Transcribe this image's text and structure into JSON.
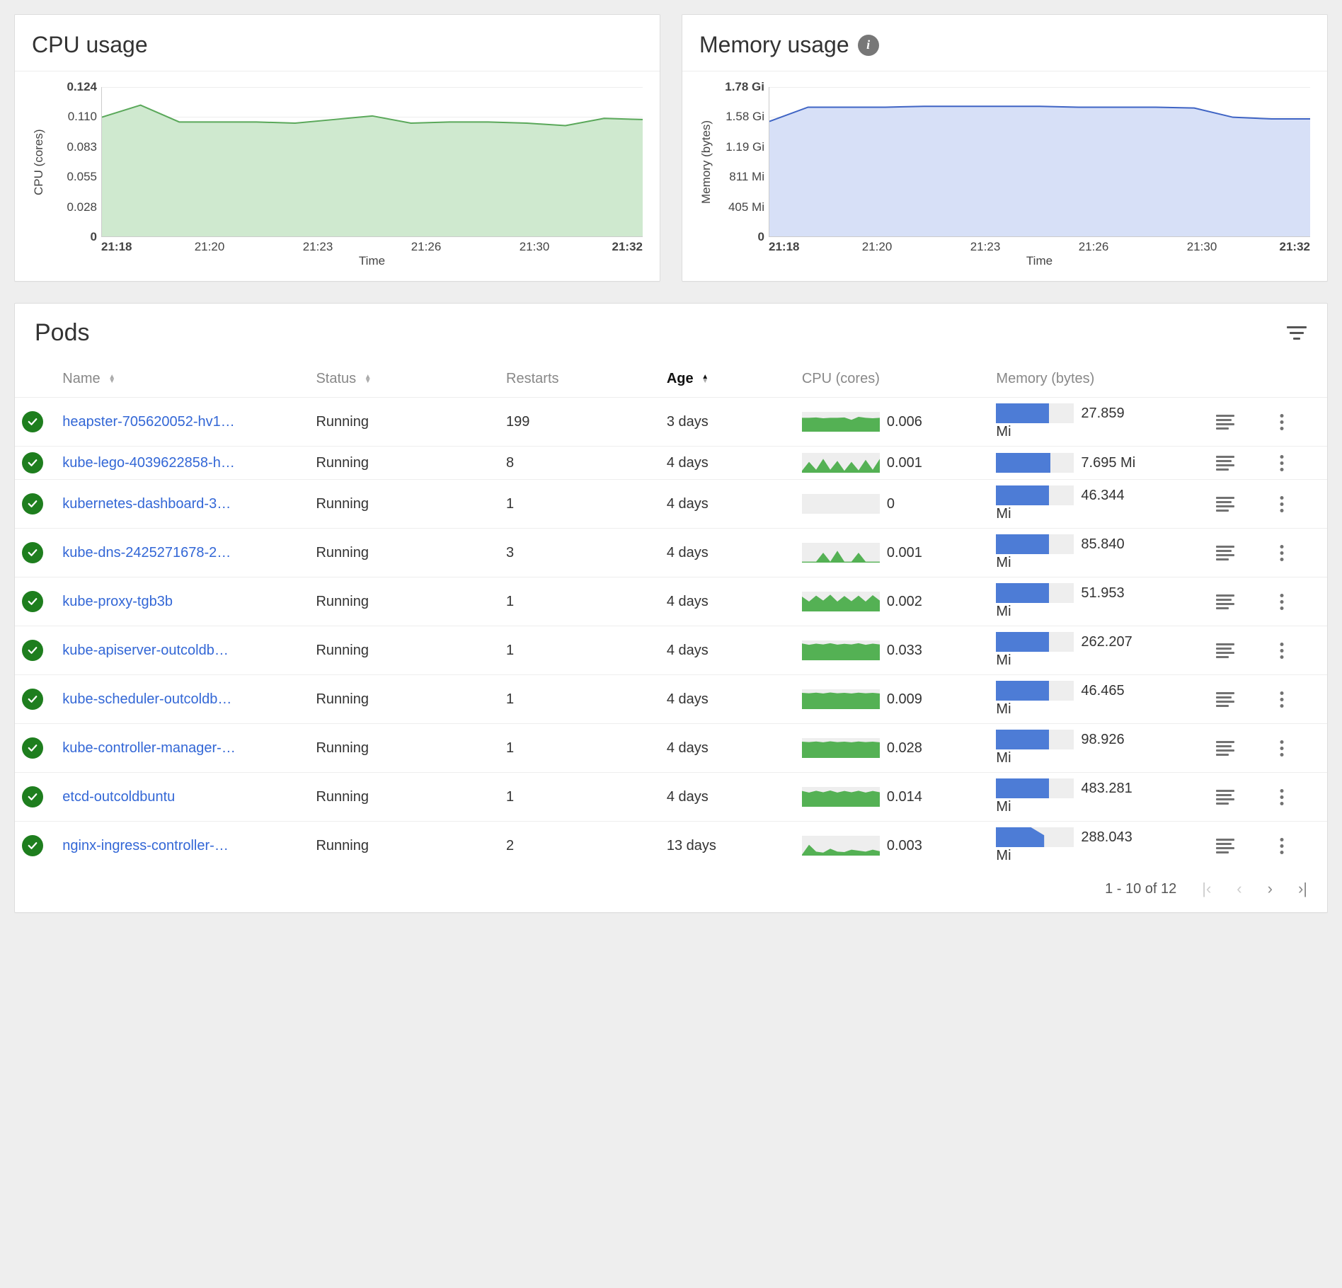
{
  "charts": {
    "cpu": {
      "title": "CPU usage",
      "y_label": "CPU (cores)",
      "x_label": "Time",
      "y_ticks": [
        "0",
        "0.028",
        "0.055",
        "0.083",
        "0.110",
        "0.124"
      ],
      "x_ticks": [
        "21:18",
        "21:20",
        "21:23",
        "21:26",
        "21:30",
        "21:32"
      ]
    },
    "memory": {
      "title": "Memory usage",
      "y_label": "Memory (bytes)",
      "x_label": "Time",
      "y_ticks": [
        "0",
        "405 Mi",
        "811 Mi",
        "1.19 Gi",
        "1.58 Gi",
        "1.78 Gi"
      ],
      "x_ticks": [
        "21:18",
        "21:20",
        "21:23",
        "21:26",
        "21:30",
        "21:32"
      ]
    }
  },
  "chart_data": [
    {
      "type": "area",
      "title": "CPU usage",
      "xlabel": "Time",
      "ylabel": "CPU (cores)",
      "ylim": [
        0,
        0.124
      ],
      "x": [
        "21:18",
        "21:19",
        "21:20",
        "21:21",
        "21:22",
        "21:23",
        "21:24",
        "21:25",
        "21:26",
        "21:27",
        "21:28",
        "21:29",
        "21:30",
        "21:31",
        "21:32"
      ],
      "series": [
        {
          "name": "CPU (cores)",
          "values": [
            0.099,
            0.109,
            0.095,
            0.095,
            0.095,
            0.094,
            0.097,
            0.1,
            0.094,
            0.095,
            0.095,
            0.094,
            0.092,
            0.098,
            0.097
          ]
        }
      ],
      "colors": {
        "line": "#5aa85a",
        "fill": "#cfe9cf"
      }
    },
    {
      "type": "area",
      "title": "Memory usage",
      "xlabel": "Time",
      "ylabel": "Memory (bytes)",
      "ylim_bytes": [
        0,
        1911260446
      ],
      "x": [
        "21:18",
        "21:19",
        "21:20",
        "21:21",
        "21:22",
        "21:23",
        "21:24",
        "21:25",
        "21:26",
        "21:27",
        "21:28",
        "21:29",
        "21:30",
        "21:31",
        "21:32"
      ],
      "series": [
        {
          "name": "Memory (bytes)",
          "values_gi": [
            1.37,
            1.54,
            1.54,
            1.54,
            1.55,
            1.55,
            1.55,
            1.55,
            1.54,
            1.54,
            1.54,
            1.53,
            1.42,
            1.4,
            1.4
          ]
        }
      ],
      "colors": {
        "line": "#3f64c4",
        "fill": "#d7e0f7"
      }
    }
  ],
  "pods": {
    "title": "Pods",
    "columns": {
      "name": "Name",
      "status": "Status",
      "restarts": "Restarts",
      "age": "Age",
      "cpu": "CPU (cores)",
      "memory": "Memory (bytes)"
    },
    "sort_column": "age",
    "sort_direction": "asc",
    "rows": [
      {
        "name": "heapster-705620052-hv1…",
        "status": "Running",
        "restarts": "199",
        "age": "3 days",
        "cpu_label": "0.006",
        "cpu_spark": [
          0.7,
          0.7,
          0.72,
          0.68,
          0.7,
          0.7,
          0.72,
          0.6,
          0.75,
          0.7,
          0.68,
          0.7
        ],
        "mem_label_val": "27.859",
        "mem_label_unit": "Mi",
        "mem_bar_pct": 68
      },
      {
        "name": "kube-lego-4039622858-h…",
        "status": "Running",
        "restarts": "8",
        "age": "4 days",
        "cpu_label": "0.001",
        "cpu_spark": [
          0.1,
          0.55,
          0.15,
          0.7,
          0.15,
          0.6,
          0.1,
          0.55,
          0.12,
          0.65,
          0.15,
          0.7
        ],
        "mem_label_val": "7.695 Mi",
        "mem_label_unit": "",
        "mem_bar_pct": 70
      },
      {
        "name": "kubernetes-dashboard-3…",
        "status": "Running",
        "restarts": "1",
        "age": "4 days",
        "cpu_label": "0",
        "cpu_spark": [
          0,
          0,
          0,
          0,
          0,
          0,
          0,
          0,
          0,
          0,
          0,
          0
        ],
        "mem_label_val": "46.344",
        "mem_label_unit": "Mi",
        "mem_bar_pct": 68
      },
      {
        "name": "kube-dns-2425271678-2…",
        "status": "Running",
        "restarts": "3",
        "age": "4 days",
        "cpu_label": "0.001",
        "cpu_spark": [
          0.05,
          0.05,
          0.05,
          0.5,
          0.05,
          0.6,
          0.05,
          0.05,
          0.5,
          0.05,
          0.05,
          0.05
        ],
        "mem_label_val": "85.840",
        "mem_label_unit": "Mi",
        "mem_bar_pct": 68
      },
      {
        "name": "kube-proxy-tgb3b",
        "status": "Running",
        "restarts": "1",
        "age": "4 days",
        "cpu_label": "0.002",
        "cpu_spark": [
          0.75,
          0.5,
          0.8,
          0.55,
          0.85,
          0.5,
          0.78,
          0.52,
          0.8,
          0.5,
          0.82,
          0.55
        ],
        "mem_label_val": "51.953",
        "mem_label_unit": "Mi",
        "mem_bar_pct": 68
      },
      {
        "name": "kube-apiserver-outcoldb…",
        "status": "Running",
        "restarts": "1",
        "age": "4 days",
        "cpu_label": "0.033",
        "cpu_spark": [
          0.85,
          0.78,
          0.84,
          0.8,
          0.86,
          0.79,
          0.83,
          0.8,
          0.86,
          0.78,
          0.84,
          0.8
        ],
        "mem_label_val": "262.207",
        "mem_label_unit": "Mi",
        "mem_bar_pct": 68
      },
      {
        "name": "kube-scheduler-outcoldb…",
        "status": "Running",
        "restarts": "1",
        "age": "4 days",
        "cpu_label": "0.009",
        "cpu_spark": [
          0.82,
          0.8,
          0.83,
          0.79,
          0.84,
          0.8,
          0.82,
          0.79,
          0.83,
          0.8,
          0.82,
          0.79
        ],
        "mem_label_val": "46.465",
        "mem_label_unit": "Mi",
        "mem_bar_pct": 68
      },
      {
        "name": "kube-controller-manager-…",
        "status": "Running",
        "restarts": "1",
        "age": "4 days",
        "cpu_label": "0.028",
        "cpu_spark": [
          0.82,
          0.8,
          0.83,
          0.79,
          0.84,
          0.8,
          0.82,
          0.79,
          0.83,
          0.8,
          0.82,
          0.79
        ],
        "mem_label_val": "98.926",
        "mem_label_unit": "Mi",
        "mem_bar_pct": 68
      },
      {
        "name": "etcd-outcoldbuntu",
        "status": "Running",
        "restarts": "1",
        "age": "4 days",
        "cpu_label": "0.014",
        "cpu_spark": [
          0.8,
          0.72,
          0.81,
          0.73,
          0.82,
          0.72,
          0.8,
          0.73,
          0.81,
          0.72,
          0.8,
          0.73
        ],
        "mem_label_val": "483.281",
        "mem_label_unit": "Mi",
        "mem_bar_pct": 68
      },
      {
        "name": "nginx-ingress-controller-…",
        "status": "Running",
        "restarts": "2",
        "age": "13 days",
        "cpu_label": "0.003",
        "cpu_spark": [
          0.05,
          0.55,
          0.2,
          0.15,
          0.35,
          0.2,
          0.18,
          0.3,
          0.25,
          0.2,
          0.3,
          0.22
        ],
        "mem_label_val": "288.043",
        "mem_label_unit": "Mi",
        "mem_bar_pct": 62,
        "mem_bar_shape": "poly"
      }
    ],
    "pagination": "1 - 10 of 12"
  }
}
